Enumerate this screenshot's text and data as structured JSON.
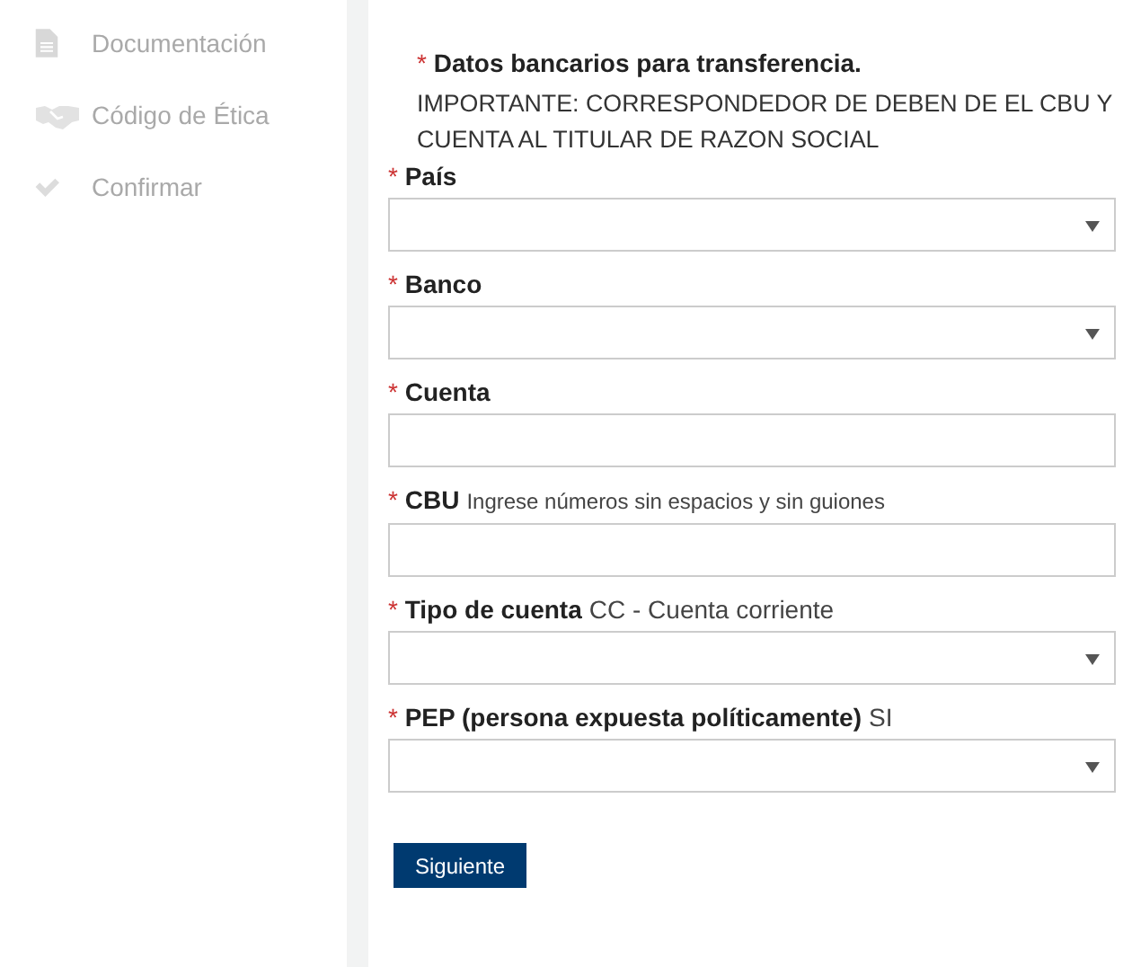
{
  "sidebar": {
    "items": [
      {
        "label": "Documentación"
      },
      {
        "label": "Código de Ética"
      },
      {
        "label": "Confirmar"
      }
    ]
  },
  "form": {
    "title_mark": "*",
    "title": "Datos bancarios para transferencia.",
    "notice": "IMPORTANTE: CORRESPONDEDOR DE DEBEN DE EL CBU Y CUENTA AL TITULAR DE RAZON SOCIAL",
    "fields": [
      {
        "mark": "*",
        "label": "País",
        "kind": "select"
      },
      {
        "mark": "*",
        "label": "Banco",
        "kind": "select"
      },
      {
        "mark": "*",
        "label": "Cuenta",
        "kind": "text"
      },
      {
        "mark": "*",
        "label": "CBU",
        "kind": "text",
        "hint": "Ingrese números sin espacios y sin guiones"
      },
      {
        "mark": "*",
        "label": "Tipo de cuenta",
        "kind": "select",
        "note": "CC - Cuenta corriente"
      },
      {
        "mark": "*",
        "label": "PEP (persona expuesta políticamente)",
        "kind": "select",
        "note": "SI"
      }
    ],
    "button": "Siguiente"
  }
}
